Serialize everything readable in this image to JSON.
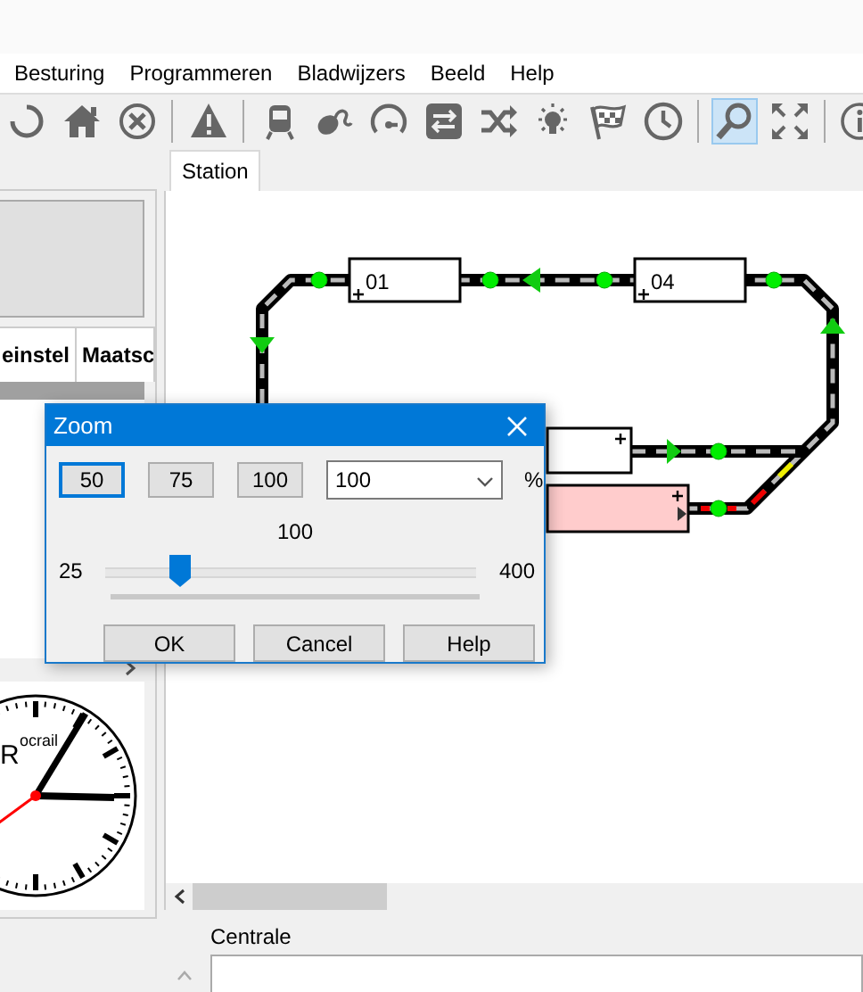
{
  "menu": [
    "Besturing",
    "Programmeren",
    "Bladwijzers",
    "Beeld",
    "Help"
  ],
  "toolbar": [
    {
      "kind": "refresh",
      "selected": false
    },
    {
      "kind": "home",
      "selected": false
    },
    {
      "kind": "stop",
      "selected": false
    },
    {
      "kind": "separator"
    },
    {
      "kind": "warning",
      "selected": false
    },
    {
      "kind": "separator"
    },
    {
      "kind": "train",
      "selected": false
    },
    {
      "kind": "mouse",
      "selected": false
    },
    {
      "kind": "gauge",
      "selected": false
    },
    {
      "kind": "switches",
      "selected": false
    },
    {
      "kind": "shuffle",
      "selected": false
    },
    {
      "kind": "bulb",
      "selected": false
    },
    {
      "kind": "flag",
      "selected": false
    },
    {
      "kind": "clock",
      "selected": false
    },
    {
      "kind": "separator"
    },
    {
      "kind": "zoom",
      "selected": true
    },
    {
      "kind": "fullscreen",
      "selected": false
    },
    {
      "kind": "separator"
    },
    {
      "kind": "info",
      "selected": false
    }
  ],
  "left_panel": {
    "table": {
      "columns": [
        "einstel",
        "Maatsc"
      ]
    },
    "clock": {
      "logo_initial": "R",
      "logo_text": "ocrail"
    }
  },
  "tabs": [
    {
      "label": "Station",
      "selected": true
    }
  ],
  "track_plan": {
    "blocks": [
      {
        "label": "01",
        "occupied": false
      },
      {
        "label": "04",
        "occupied": false
      },
      {
        "occupied": false
      },
      {
        "occupied": true
      }
    ]
  },
  "dialog": {
    "title": "Zoom",
    "presets": [
      {
        "label": "50",
        "selected": true
      },
      {
        "label": "75",
        "selected": false
      },
      {
        "label": "100",
        "selected": false
      }
    ],
    "combo_value": "100",
    "unit": "%",
    "slider": {
      "reading": "100",
      "min_label": "25",
      "max_label": "400",
      "level": 0.2
    },
    "buttons": [
      "OK",
      "Cancel",
      "Help"
    ]
  },
  "bottom": {
    "label": "Centrale"
  }
}
